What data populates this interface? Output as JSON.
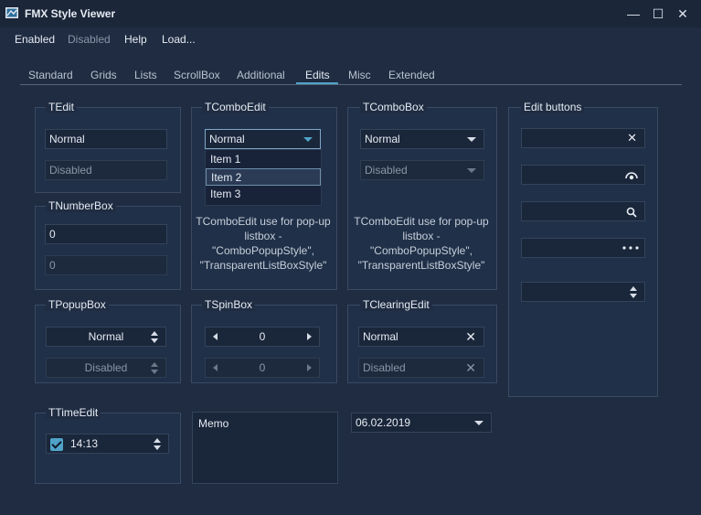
{
  "window": {
    "title": "FMX Style Viewer",
    "controls": {
      "minimize": "—",
      "maximize": "☐",
      "close": "✕"
    }
  },
  "menu": [
    {
      "label": "Enabled",
      "enabled": true
    },
    {
      "label": "Disabled",
      "enabled": false
    },
    {
      "label": "Help",
      "enabled": true
    },
    {
      "label": "Load...",
      "enabled": true
    }
  ],
  "tabs": [
    "Standard",
    "Grids",
    "Lists",
    "ScrollBox",
    "Additional",
    "Edits",
    "Misc",
    "Extended"
  ],
  "active_tab": "Edits",
  "groups": {
    "tedit": {
      "title": "TEdit",
      "normal": "Normal",
      "disabled": "Disabled"
    },
    "tnumberbox": {
      "title": "TNumberBox",
      "normal": "0",
      "disabled": "0"
    },
    "tcomboedit": {
      "title": "TComboEdit",
      "value": "Normal",
      "items": [
        "Item 1",
        "Item 2",
        "Item 3"
      ],
      "selected_item": "Item 2",
      "note_lines": [
        "TComboEdit use for pop-up",
        "listbox -",
        "\"ComboPopupStyle\",",
        "\"TransparentListBoxStyle\""
      ]
    },
    "tcombobox": {
      "title": "TComboBox",
      "normal": "Normal",
      "disabled": "Disabled",
      "note_lines": [
        "TComboEdit use for pop-up",
        "listbox -",
        "\"ComboPopupStyle\",",
        "\"TransparentListBoxStyle\""
      ]
    },
    "editbuttons": {
      "title": "Edit buttons",
      "icons": [
        "close-icon",
        "password-eye-icon",
        "search-icon",
        "ellipsis-icon",
        "spin-icon"
      ]
    },
    "tpopupbox": {
      "title": "TPopupBox",
      "normal": "Normal",
      "disabled": "Disabled"
    },
    "tspinbox": {
      "title": "TSpinBox",
      "normal": "0",
      "disabled": "0"
    },
    "tclearingedit": {
      "title": "TClearingEdit",
      "normal": "Normal",
      "disabled": "Disabled",
      "clear_glyph": "✕"
    },
    "ttimeedit": {
      "title": "TTimeEdit",
      "value": "14:13",
      "checked": true
    }
  },
  "memo": {
    "text": "Memo"
  },
  "dateedit": {
    "value": "06.02.2019"
  },
  "colors": {
    "accent": "#4fa3c8",
    "background": "#1f2c42"
  }
}
